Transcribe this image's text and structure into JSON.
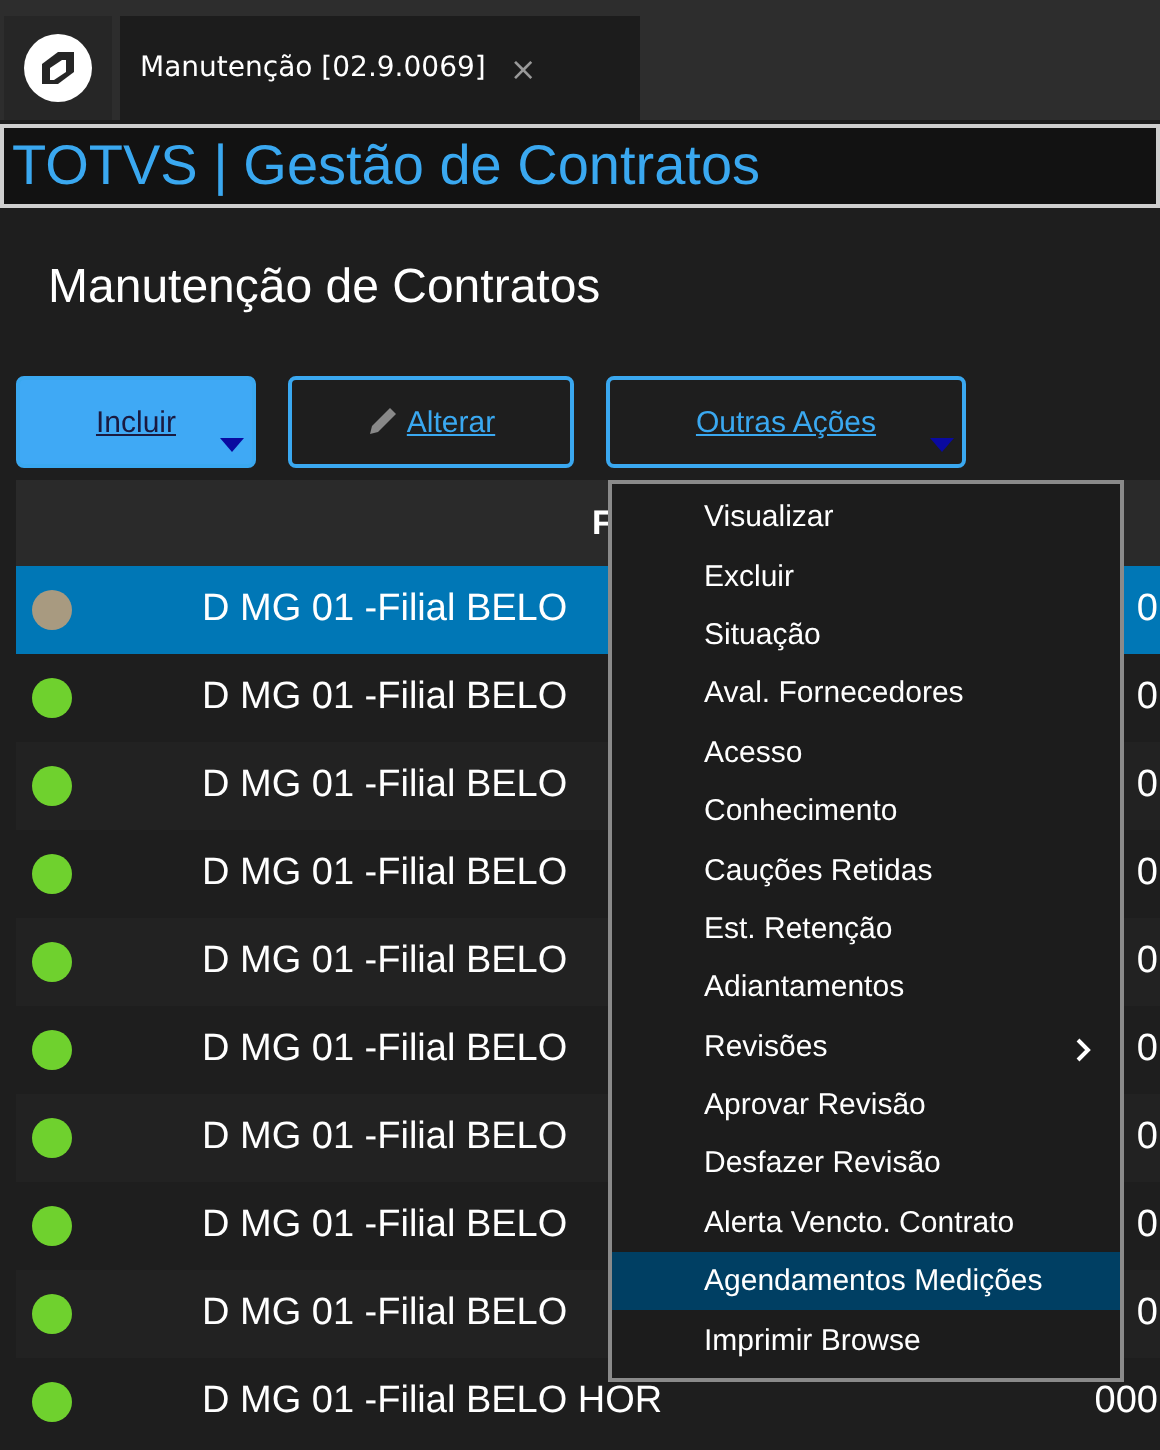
{
  "tab": {
    "title": "Manutenção [02.9.0069]",
    "close": "×"
  },
  "app_title": "TOTVS | Gestão de Contratos",
  "page_title": "Manutenção de Contratos",
  "buttons": [
    {
      "kind": "primary",
      "label": "Incluir",
      "dropdown": true
    },
    {
      "kind": "edit",
      "label": "Alterar",
      "dropdown": false
    },
    {
      "kind": "outline",
      "label": "Outras Ações",
      "dropdown": true
    }
  ],
  "table": {
    "columns": [
      "F"
    ],
    "rows": [
      {
        "color": "#a89a80",
        "column_1": "D MG 01 -Filial BELO",
        "column_2": "0",
        "selected": true
      },
      {
        "color": "#6fd12e",
        "column_1": "D MG 01 -Filial BELO",
        "column_2": "0",
        "selected": false
      },
      {
        "color": "#6fd12e",
        "column_1": "D MG 01 -Filial BELO",
        "column_2": "0",
        "selected": false
      },
      {
        "color": "#6fd12e",
        "column_1": "D MG 01 -Filial BELO",
        "column_2": "0",
        "selected": false
      },
      {
        "color": "#6fd12e",
        "column_1": "D MG 01 -Filial BELO",
        "column_2": "0",
        "selected": false
      },
      {
        "color": "#6fd12e",
        "column_1": "D MG 01 -Filial BELO",
        "column_2": "0",
        "selected": false
      },
      {
        "color": "#6fd12e",
        "column_1": "D MG 01 -Filial BELO",
        "column_2": "0",
        "selected": false
      },
      {
        "color": "#6fd12e",
        "column_1": "D MG 01 -Filial BELO",
        "column_2": "0",
        "selected": false
      },
      {
        "color": "#6fd12e",
        "column_1": "D MG 01 -Filial BELO",
        "column_2": "0",
        "selected": false
      },
      {
        "color": "#6fd12e",
        "column_1": "D MG 01 -Filial BELO HOR",
        "column_2": "000",
        "selected": false
      }
    ]
  },
  "menu": {
    "items": [
      {
        "label": "Visualizar",
        "selected": false,
        "submenu": false
      },
      {
        "label": "Excluir",
        "selected": false,
        "submenu": false
      },
      {
        "label": "Situação",
        "selected": false,
        "submenu": false
      },
      {
        "label": "Aval. Fornecedores",
        "selected": false,
        "submenu": false
      },
      {
        "label": "Acesso",
        "selected": false,
        "submenu": false
      },
      {
        "label": "Conhecimento",
        "selected": false,
        "submenu": false
      },
      {
        "label": "Cauções Retidas",
        "selected": false,
        "submenu": false
      },
      {
        "label": "Est. Retenção",
        "selected": false,
        "submenu": false
      },
      {
        "label": "Adiantamentos",
        "selected": false,
        "submenu": false
      },
      {
        "label": "Revisões",
        "selected": false,
        "submenu": true
      },
      {
        "label": "Aprovar Revisão",
        "selected": false,
        "submenu": false
      },
      {
        "label": "Desfazer Revisão",
        "selected": false,
        "submenu": false
      },
      {
        "label": "Alerta Vencto. Contrato",
        "selected": false,
        "submenu": false
      },
      {
        "label": "Agendamentos Medições",
        "selected": true,
        "submenu": false
      },
      {
        "label": "Imprimir Browse",
        "selected": false,
        "submenu": false
      }
    ]
  }
}
